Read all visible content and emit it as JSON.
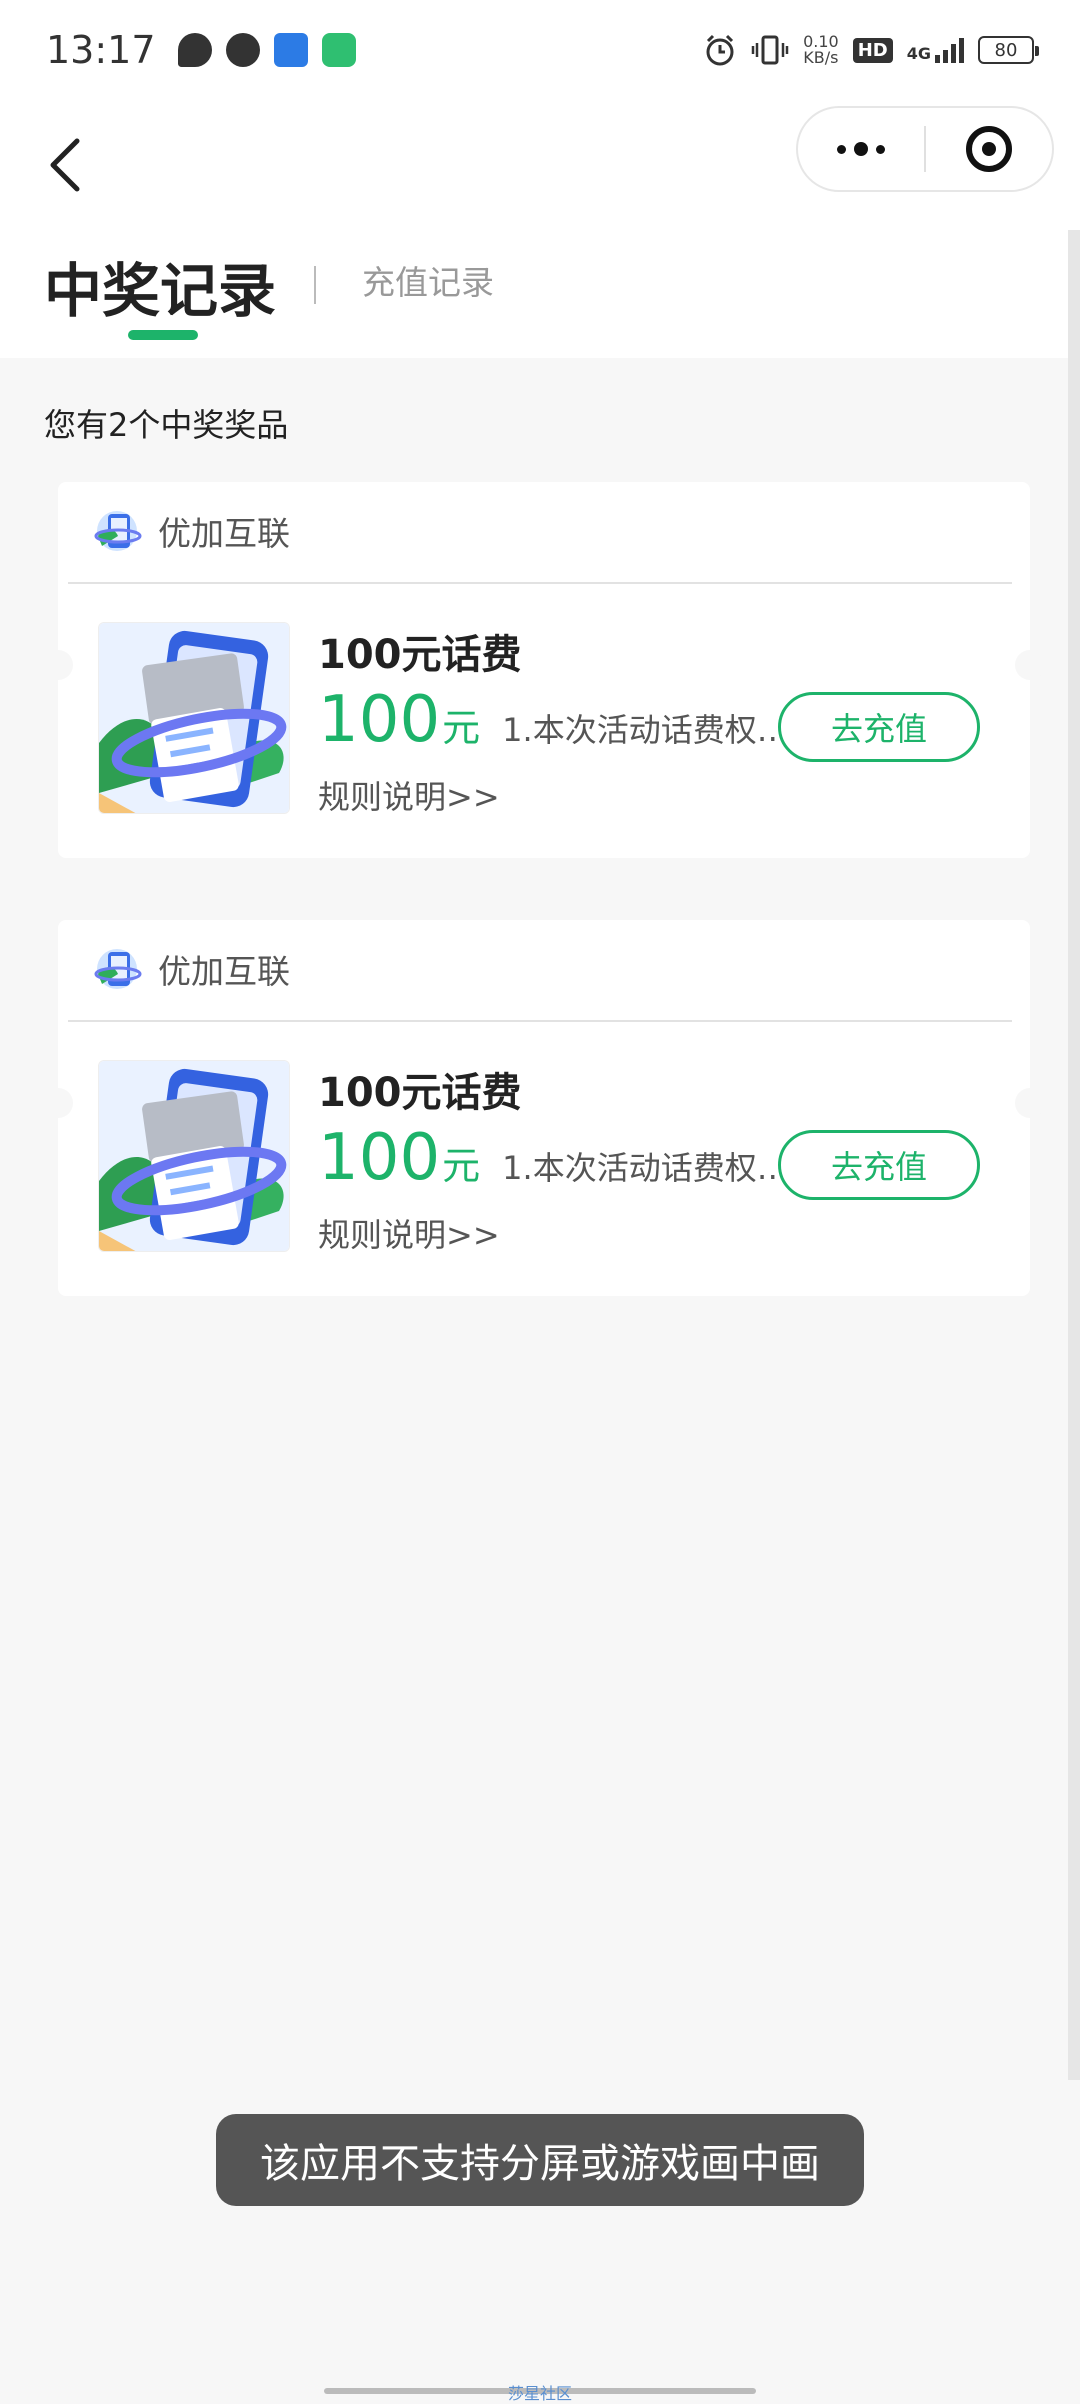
{
  "status_bar": {
    "time": "13:17",
    "net_speed_value": "0.10",
    "net_speed_unit": "KB/s",
    "hd_label": "HD",
    "network_label": "4G",
    "battery_level": "80"
  },
  "tabs": {
    "active_label": "中奖记录",
    "inactive_label": "充值记录"
  },
  "summary_text": "您有2个中奖奖品",
  "prizes": [
    {
      "brand": "优加互联",
      "title": "100元话费",
      "amount": "100",
      "unit": "元",
      "desc": "1.本次活动话费权…",
      "rules_label": "规则说明>>",
      "button_label": "去充值"
    },
    {
      "brand": "优加互联",
      "title": "100元话费",
      "amount": "100",
      "unit": "元",
      "desc": "1.本次活动话费权…",
      "rules_label": "规则说明>>",
      "button_label": "去充值"
    }
  ],
  "toast_text": "该应用不支持分屏或游戏画中画",
  "watermark_text": "莎星社区",
  "colors": {
    "accent": "#1db36a",
    "background": "#f7f7f7",
    "card": "#ffffff"
  }
}
